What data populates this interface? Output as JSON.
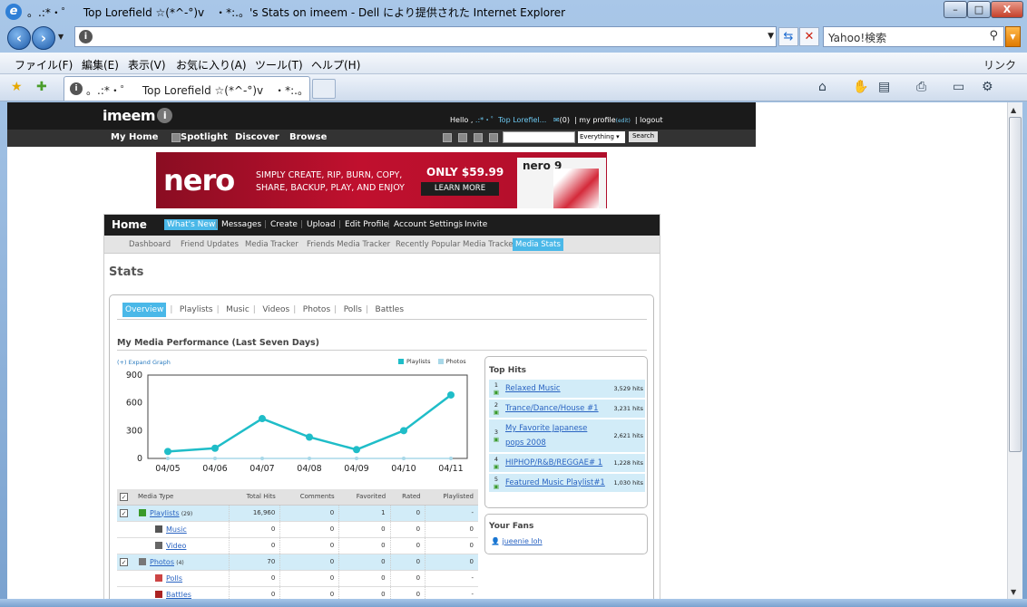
{
  "window": {
    "title": "。.:*・゜　Top Lorefield ☆(*^-°)v　・*:.。's Stats on imeem - Dell により提供された Internet Explorer",
    "min": "–",
    "max": "□",
    "close": "X"
  },
  "browser": {
    "search_placeholder": "Yahoo!検索",
    "menu": [
      "ファイル(F)",
      "編集(E)",
      "表示(V)",
      "お気に入り(A)",
      "ツール(T)",
      "ヘルプ(H)"
    ],
    "links": "リンク",
    "tab_title": "。.:*・゜　Top Lorefield ☆(*^-°)v　・*:.。'..."
  },
  "imeem": {
    "logo": "imeem",
    "hello": "Hello ,",
    "user": ".:*・゜Top Lorefiel...",
    "msgs": "(0)",
    "myprofile": "my profile",
    "edit": "(edit)",
    "logout": "logout",
    "nav": [
      "My Home",
      "Spotlight",
      "Discover",
      "Browse"
    ],
    "search_scope": "Everything",
    "search_btn": "Search"
  },
  "banner": {
    "brand": "nero",
    "line1": "SIMPLY CREATE, RIP, BURN, COPY,",
    "line2": "SHARE, BACKUP, PLAY, AND ENJOY",
    "price": "ONLY $59.99",
    "cta": "LEARN MORE",
    "box": "nero 9"
  },
  "home": {
    "title": "Home",
    "nav": [
      "What's New",
      "Messages",
      "Create",
      "Upload",
      "Edit Profile",
      "Account Settings",
      "Invite"
    ],
    "sub": [
      "Dashboard",
      "Friend Updates",
      "Media Tracker",
      "Friends Media Tracker",
      "Recently Popular Media Tracker",
      "Media Stats"
    ]
  },
  "stats": {
    "title": "Stats",
    "tabs": [
      "Overview",
      "Playlists",
      "Music",
      "Videos",
      "Photos",
      "Polls",
      "Battles"
    ],
    "perf_title": "My Media Performance (Last Seven Days)",
    "expand": "(+) Expand Graph",
    "legend": [
      "Playlists",
      "Photos"
    ]
  },
  "chart_data": {
    "type": "line",
    "categories": [
      "04/05",
      "04/06",
      "04/07",
      "04/08",
      "04/09",
      "04/10",
      "04/11"
    ],
    "series": [
      {
        "name": "Playlists",
        "values": [
          75,
          110,
          430,
          230,
          95,
          300,
          685
        ]
      },
      {
        "name": "Photos",
        "values": [
          0,
          0,
          0,
          0,
          0,
          0,
          0
        ]
      }
    ],
    "yticks": [
      0,
      300,
      600,
      900
    ],
    "ylim": [
      0,
      900
    ],
    "colors": {
      "Playlists": "#1fbdc8",
      "Photos": "#a8d8e8"
    }
  },
  "table": {
    "headers": [
      "Media Type",
      "Total Hits",
      "Comments",
      "Favorited",
      "Rated",
      "Playlisted"
    ],
    "rows": [
      {
        "main": true,
        "name": "Playlists",
        "count": "(29)",
        "vals": [
          "16,960",
          "0",
          "1",
          "0",
          "-"
        ]
      },
      {
        "main": false,
        "name": "Music",
        "count": "",
        "vals": [
          "0",
          "0",
          "0",
          "0",
          "0"
        ]
      },
      {
        "main": false,
        "name": "Video",
        "count": "",
        "vals": [
          "0",
          "0",
          "0",
          "0",
          "0"
        ]
      },
      {
        "main": true,
        "name": "Photos",
        "count": "(4)",
        "vals": [
          "70",
          "0",
          "0",
          "0",
          "0"
        ]
      },
      {
        "main": false,
        "name": "Polls",
        "count": "",
        "vals": [
          "0",
          "0",
          "0",
          "0",
          "-"
        ]
      },
      {
        "main": false,
        "name": "Battles",
        "count": "",
        "vals": [
          "0",
          "0",
          "0",
          "0",
          "-"
        ]
      }
    ]
  },
  "tophits": {
    "title": "Top Hits",
    "items": [
      {
        "n": "1",
        "name": "Relaxed Music",
        "hits": "3,529 hits"
      },
      {
        "n": "2",
        "name": "Trance/Dance/House #1",
        "hits": "3,231 hits"
      },
      {
        "n": "3",
        "name": "My Favorite Japanese pops 2008",
        "hits": "2,621 hits"
      },
      {
        "n": "4",
        "name": "HIPHOP/R&B/REGGAE# 1",
        "hits": "1,228 hits"
      },
      {
        "n": "5",
        "name": "Featured Music Playlist#1",
        "hits": "1,030 hits"
      }
    ]
  },
  "fans": {
    "title": "Your Fans",
    "items": [
      "jueenie loh"
    ]
  }
}
